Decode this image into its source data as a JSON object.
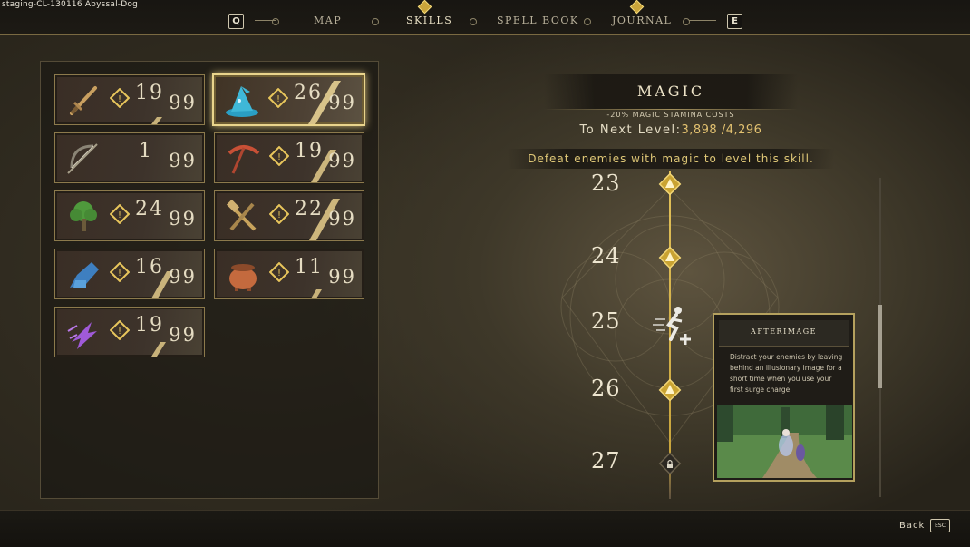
{
  "build_label": "staging-CL-130116 Abyssal-Dog",
  "nav": {
    "left_key": "Q",
    "right_key": "E",
    "tabs": [
      {
        "label": "MAP"
      },
      {
        "label": "SKILLS"
      },
      {
        "label": "SPELL BOOK"
      },
      {
        "label": "JOURNAL"
      }
    ],
    "active_tab": "SKILLS"
  },
  "skills": [
    {
      "icon": "sword-icon",
      "level": "19",
      "max": "99",
      "alert": true,
      "selected": false
    },
    {
      "icon": "wizard-hat-icon",
      "level": "26",
      "max": "99",
      "alert": true,
      "selected": true
    },
    {
      "icon": "bow-icon",
      "level": "1",
      "max": "99",
      "alert": false,
      "selected": false
    },
    {
      "icon": "pickaxe-icon",
      "level": "19",
      "max": "99",
      "alert": true,
      "selected": false
    },
    {
      "icon": "tree-icon",
      "level": "24",
      "max": "99",
      "alert": true,
      "selected": false
    },
    {
      "icon": "hammer-icon",
      "level": "22",
      "max": "99",
      "alert": true,
      "selected": false
    },
    {
      "icon": "blue-gauntlet-icon",
      "level": "16",
      "max": "99",
      "alert": true,
      "selected": false
    },
    {
      "icon": "cauldron-icon",
      "level": "11",
      "max": "99",
      "alert": true,
      "selected": false
    },
    {
      "icon": "purple-dash-icon",
      "level": "19",
      "max": "99",
      "alert": true,
      "selected": false
    }
  ],
  "detail": {
    "title": "MAGIC",
    "bonus": "-20% MAGIC STAMINA COSTS",
    "next_level_label": "To Next Level:",
    "next_level_value": "3,898 /4,296",
    "hint": "Defeat enemies with magic to level this skill."
  },
  "tree": [
    {
      "level": "23",
      "node": "magic-hat-node-icon",
      "state": "unlocked"
    },
    {
      "level": "24",
      "node": "magic-hat-node-icon",
      "state": "unlocked"
    },
    {
      "level": "25",
      "node": "afterimage-runner-icon",
      "state": "perk"
    },
    {
      "level": "26",
      "node": "magic-hat-node-icon",
      "state": "unlocked"
    },
    {
      "level": "27",
      "node": "lock-icon",
      "state": "locked"
    }
  ],
  "tooltip": {
    "title": "AFTERIMAGE",
    "description": "Distract your enemies by leaving behind an illusionary image for a short time when you use your first surge charge."
  },
  "footer": {
    "back_label": "Back",
    "back_key": "ESC"
  },
  "colors": {
    "gold": "#e2c15a",
    "accent_text": "#e1c978",
    "panel_border": "#8c7a4c"
  }
}
